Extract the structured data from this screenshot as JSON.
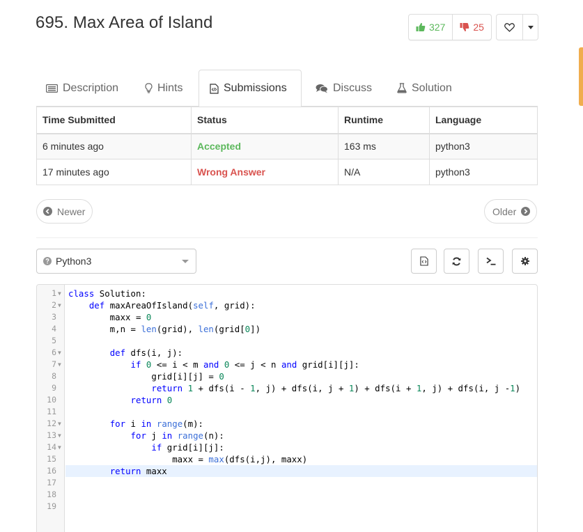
{
  "problem": {
    "title": "695. Max Area of Island"
  },
  "votes": {
    "up_count": "327",
    "down_count": "25"
  },
  "tabs": [
    {
      "label": "Description",
      "icon": "list-icon"
    },
    {
      "label": "Hints",
      "icon": "lightbulb-icon"
    },
    {
      "label": "Submissions",
      "icon": "code-file-icon",
      "active": true
    },
    {
      "label": "Discuss",
      "icon": "comments-icon"
    },
    {
      "label": "Solution",
      "icon": "flask-icon"
    }
  ],
  "submissions": {
    "headers": [
      "Time Submitted",
      "Status",
      "Runtime",
      "Language"
    ],
    "rows": [
      {
        "time": "6 minutes ago",
        "status": "Accepted",
        "runtime": "163 ms",
        "language": "python3"
      },
      {
        "time": "17 minutes ago",
        "status": "Wrong Answer",
        "runtime": "N/A",
        "language": "python3"
      }
    ]
  },
  "pager": {
    "newer": "Newer",
    "older": "Older"
  },
  "editor": {
    "language": "Python3",
    "lines": [
      "class Solution:",
      "    def maxAreaOfIsland(self, grid):",
      "        maxx = 0",
      "        m,n = len(grid), len(grid[0])",
      "",
      "        def dfs(i, j):",
      "            if 0 <= i < m and 0 <= j < n and grid[i][j]:",
      "                grid[i][j] = 0",
      "                return 1 + dfs(i - 1, j) + dfs(i, j + 1) + dfs(i + 1, j) + dfs(i, j -1)",
      "            return 0",
      "",
      "        for i in range(m):",
      "            for j in range(n):",
      "                if grid[i][j]:",
      "                    maxx = max(dfs(i,j), maxx)",
      "        return maxx",
      "",
      "",
      ""
    ]
  },
  "colors": {
    "accepted": "#5cb85c",
    "wrong": "#d9534f",
    "side_tab": "#f0ad4e"
  }
}
